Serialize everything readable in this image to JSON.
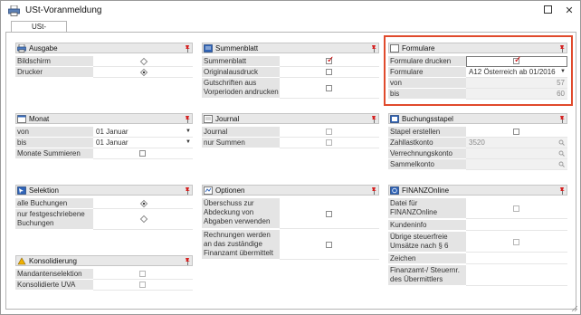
{
  "window": {
    "title": "USt-Voranmeldung"
  },
  "tab": {
    "label": "USt-Voranmeldung"
  },
  "groups": {
    "ausgabe": {
      "title": "Ausgabe",
      "rows": [
        "Bildschirm",
        "Drucker"
      ]
    },
    "summenblatt": {
      "title": "Summenblatt",
      "rows": [
        "Summenblatt",
        "Originalausdruck",
        "Gutschriften aus Vorperioden andrucken"
      ]
    },
    "formulare": {
      "title": "Formulare",
      "rows": [
        "Formulare drucken",
        "Formulare",
        "von",
        "bis"
      ],
      "formular_value": "A12 Österreich ab 01/2016",
      "von_value": "57",
      "bis_value": "60"
    },
    "monat": {
      "title": "Monat",
      "rows": [
        "von",
        "bis",
        "Monate Summieren"
      ],
      "von_value": "01 Januar",
      "bis_value": "01 Januar"
    },
    "journal": {
      "title": "Journal",
      "rows": [
        "Journal",
        "nur Summen"
      ]
    },
    "buchungsstapel": {
      "title": "Buchungsstapel",
      "rows": [
        "Stapel erstellen",
        "Zahllastkonto",
        "Verrechnungskonto",
        "Sammelkonto"
      ],
      "zahllastkonto_value": "3520"
    },
    "selektion": {
      "title": "Selektion",
      "rows": [
        "alle Buchungen",
        "nur festgeschriebene Buchungen"
      ]
    },
    "optionen": {
      "title": "Optionen",
      "rows": [
        "Überschuss zur Abdeckung von Abgaben verwenden",
        "Rechnungen werden an das zuständige Finanzamt übermittelt"
      ]
    },
    "finanzonline": {
      "title": "FINANZOnline",
      "rows": [
        "Datei für FINANZOnline erzeugen",
        "Kundeninfo",
        "Übrige steuerfreie Umsätze nach § 6",
        "Zeichen",
        "Finanzamt-/ Steuernr. des Übermittlers"
      ]
    },
    "konsolidierung": {
      "title": "Konsolidierung",
      "rows": [
        "Mandantenselektion",
        "Konsolidierte UVA"
      ]
    }
  },
  "colors": {
    "highlight": "#e04a2c",
    "checkmark": "#cc0000",
    "header_bg": "#e8e8e8"
  }
}
